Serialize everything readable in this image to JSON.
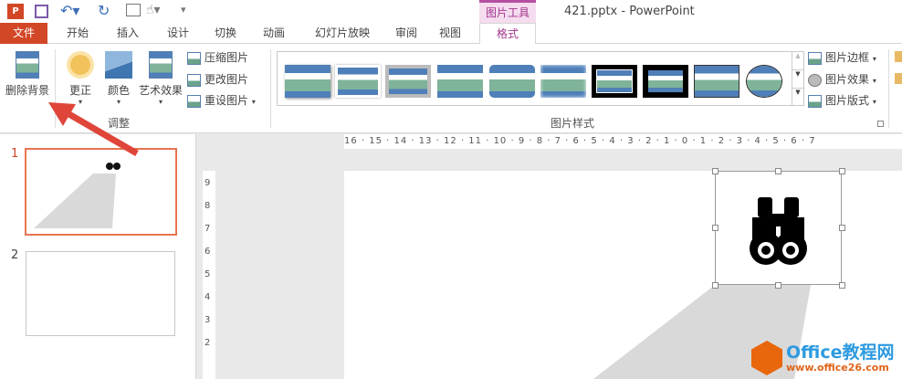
{
  "window": {
    "title": "421.pptx - PowerPoint",
    "contextual_tab_group": "图片工具"
  },
  "quick_access": [
    "save-icon",
    "undo-icon",
    "redo-icon",
    "slideshow-icon",
    "touch-mode-icon",
    "customize-icon"
  ],
  "tabs": [
    "文件",
    "开始",
    "插入",
    "设计",
    "切换",
    "动画",
    "幻灯片放映",
    "审阅",
    "视图",
    "格式"
  ],
  "active_tab": "格式",
  "ribbon": {
    "adjust": {
      "label": "调整",
      "remove_bg": "删除背景",
      "corrections": "更正",
      "color": "颜色",
      "artistic": "艺术效果",
      "compress": "压缩图片",
      "change": "更改图片",
      "reset": "重设图片"
    },
    "styles": {
      "label": "图片样式",
      "border": "图片边框",
      "effects": "图片效果",
      "layout": "图片版式"
    }
  },
  "ruler": {
    "horizontal": "16 · 15 · 14 · 13 · 12 · 11 · 10 · 9 · 8 · 7 · 6 · 5 · 4 · 3 · 2 · 1 · 0 · 1 · 2 · 3 · 4 · 5 · 6 · 7",
    "vertical": [
      "9",
      "8",
      "7",
      "6",
      "5",
      "4",
      "3",
      "2"
    ]
  },
  "slides": [
    {
      "number": "1"
    },
    {
      "number": "2"
    }
  ],
  "watermark": {
    "brand": "Office教程网",
    "url": "www.office26.com"
  },
  "colors": {
    "file_tab": "#d24726",
    "accent": "#b7472a",
    "selected_thumb": "#e8734f",
    "arrow": "#e0453a"
  }
}
